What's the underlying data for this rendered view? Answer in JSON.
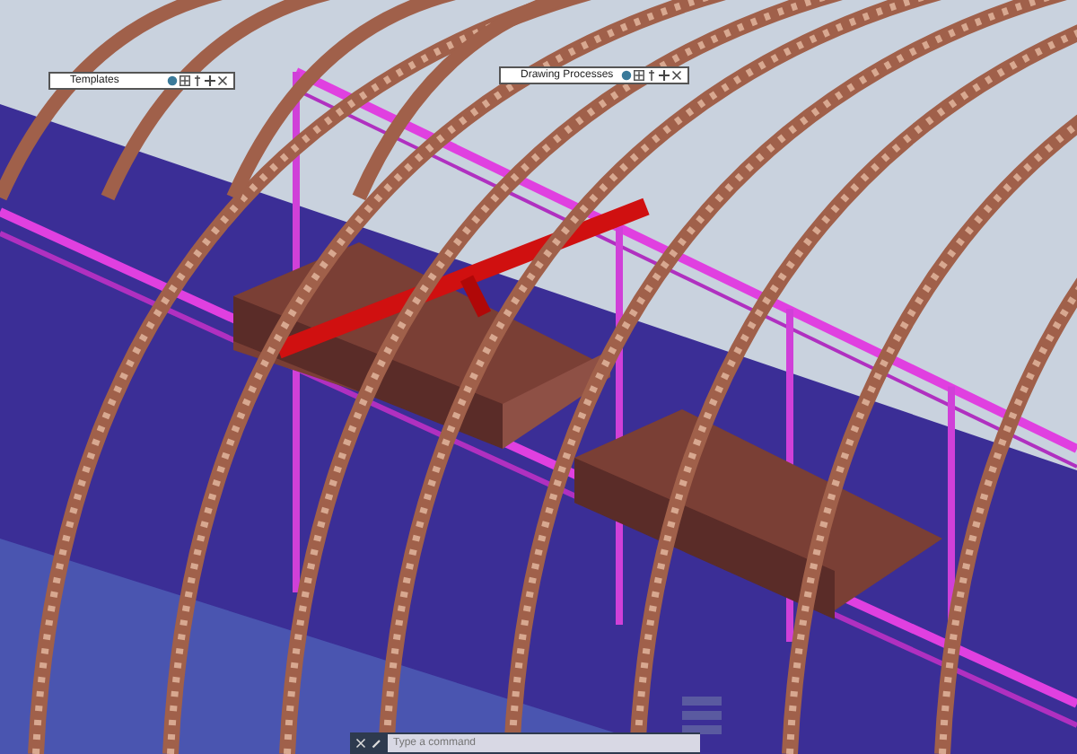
{
  "palettes": [
    {
      "title": "Templates"
    },
    {
      "title": "Drawing Processes"
    }
  ],
  "command_line": {
    "placeholder": "Type a command"
  }
}
